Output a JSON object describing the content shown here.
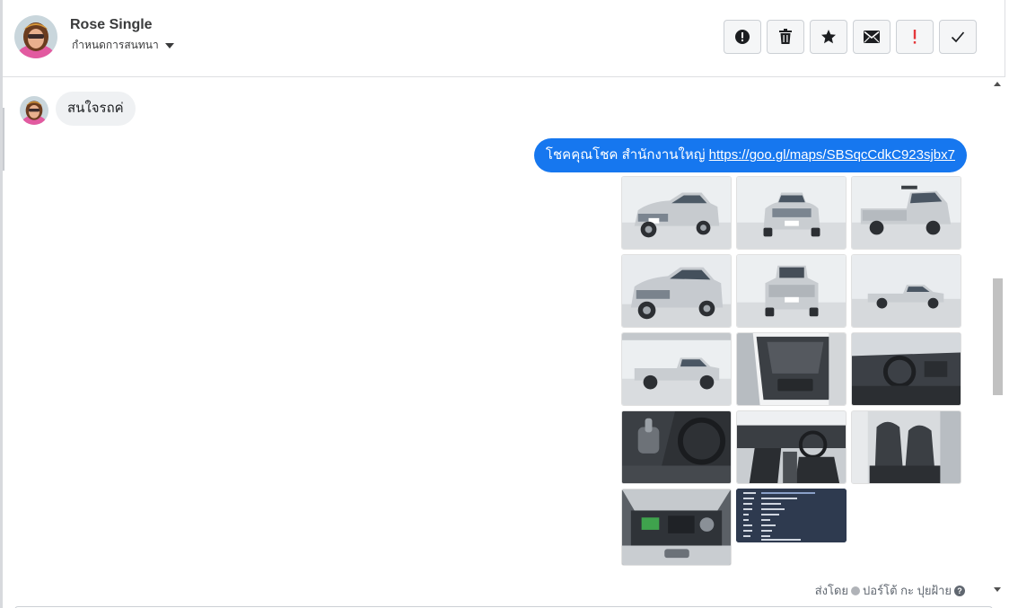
{
  "header": {
    "name": "Rose Single",
    "subtitle": "กำหนดการสนทนา",
    "actions": [
      {
        "icon": "alert-circle-icon",
        "label": "report"
      },
      {
        "icon": "trash-icon",
        "label": "delete"
      },
      {
        "icon": "star-icon",
        "label": "star"
      },
      {
        "icon": "envelope-icon",
        "label": "unread"
      },
      {
        "icon": "exclamation-icon",
        "label": "flag"
      },
      {
        "icon": "checkmark-icon",
        "label": "done"
      }
    ]
  },
  "thread": {
    "incoming_message": "สนใจรถค่",
    "outgoing_text": "โชคคุณโชค สำนักงานใหญ่ ",
    "outgoing_link": "https://goo.gl/maps/SBSqcCdkC923sjbx7",
    "photos": [
      {
        "kind": "car-front-3q"
      },
      {
        "kind": "car-front"
      },
      {
        "kind": "car-rear-3q"
      },
      {
        "kind": "car-front-3q"
      },
      {
        "kind": "car-rear"
      },
      {
        "kind": "car-side-far"
      },
      {
        "kind": "car-side"
      },
      {
        "kind": "door-panel"
      },
      {
        "kind": "dashboard"
      },
      {
        "kind": "gear-shift"
      },
      {
        "kind": "cabin"
      },
      {
        "kind": "seats"
      },
      {
        "kind": "engine"
      },
      {
        "kind": "document"
      }
    ],
    "sent_by_label": "ส่งโดย",
    "sent_by_name": "ปอร์โต้ กะ ปุยฝ้าย"
  },
  "colors": {
    "accent": "#1677ef",
    "incoming_bubble": "#eff1f3",
    "flag_red": "#e4373a"
  }
}
